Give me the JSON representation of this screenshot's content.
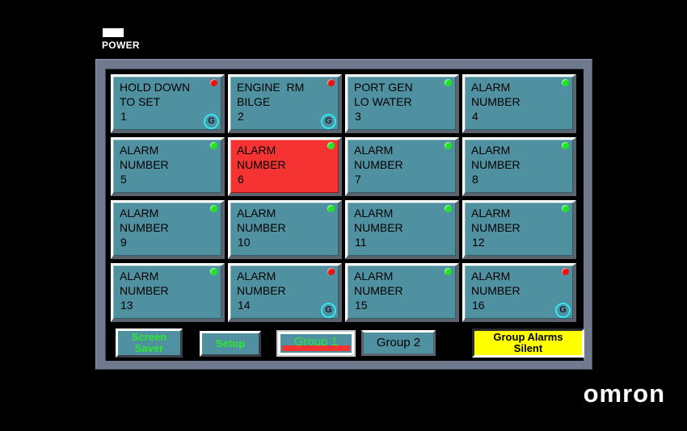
{
  "device": {
    "brand": "omron",
    "power_label": "POWER",
    "power_led_color": "#ffffff",
    "bezel_color": "#6f7a8f",
    "screen_color": "#000000"
  },
  "colors": {
    "tile_normal": "#4f91a0",
    "tile_alarm": "#f53333",
    "led_green": "#22e422",
    "led_red": "#ee1111",
    "group_badge": "#33e8f0",
    "label_green": "#2ee82e",
    "silent_yellow": "#ffff00"
  },
  "alarm_grid": {
    "columns": 4,
    "rows": 4,
    "tiles": [
      {
        "line1": "HOLD DOWN",
        "line2": "TO SET",
        "number": "1",
        "led": "red",
        "state": "normal",
        "group_badge": "G"
      },
      {
        "line1": "ENGINE  RM",
        "line2": "BILGE",
        "number": "2",
        "led": "red",
        "state": "normal",
        "group_badge": "G"
      },
      {
        "line1": "PORT GEN",
        "line2": "LO WATER",
        "number": "3",
        "led": "green",
        "state": "normal",
        "group_badge": ""
      },
      {
        "line1": "ALARM",
        "line2": "NUMBER",
        "number": "4",
        "led": "green",
        "state": "normal",
        "group_badge": ""
      },
      {
        "line1": "ALARM",
        "line2": "NUMBER",
        "number": "5",
        "led": "green",
        "state": "normal",
        "group_badge": ""
      },
      {
        "line1": "ALARM",
        "line2": "NUMBER",
        "number": "6",
        "led": "green",
        "state": "alarm",
        "group_badge": ""
      },
      {
        "line1": "ALARM",
        "line2": "NUMBER",
        "number": "7",
        "led": "green",
        "state": "normal",
        "group_badge": ""
      },
      {
        "line1": "ALARM",
        "line2": "NUMBER",
        "number": "8",
        "led": "green",
        "state": "normal",
        "group_badge": ""
      },
      {
        "line1": "ALARM",
        "line2": "NUMBER",
        "number": "9",
        "led": "green",
        "state": "normal",
        "group_badge": ""
      },
      {
        "line1": "ALARM",
        "line2": "NUMBER",
        "number": "10",
        "led": "green",
        "state": "normal",
        "group_badge": ""
      },
      {
        "line1": "ALARM",
        "line2": "NUMBER",
        "number": "11",
        "led": "green",
        "state": "normal",
        "group_badge": ""
      },
      {
        "line1": "ALARM",
        "line2": "NUMBER",
        "number": "12",
        "led": "green",
        "state": "normal",
        "group_badge": ""
      },
      {
        "line1": "ALARM",
        "line2": "NUMBER",
        "number": "13",
        "led": "green",
        "state": "normal",
        "group_badge": ""
      },
      {
        "line1": "ALARM",
        "line2": "NUMBER",
        "number": "14",
        "led": "red",
        "state": "normal",
        "group_badge": "G"
      },
      {
        "line1": "ALARM",
        "line2": "NUMBER",
        "number": "15",
        "led": "green",
        "state": "normal",
        "group_badge": ""
      },
      {
        "line1": "ALARM",
        "line2": "NUMBER",
        "number": "16",
        "led": "red",
        "state": "normal",
        "group_badge": "G"
      }
    ]
  },
  "button_bar": {
    "screen_saver": {
      "line1": "Screen",
      "line2": "Saver"
    },
    "setup": {
      "line1": "Setup",
      "line2": ""
    },
    "group1": {
      "line1": "Group 1",
      "line2": "",
      "active": true
    },
    "group2": {
      "line1": "Group 2",
      "line2": "",
      "active": false
    },
    "group_alarms_silent": {
      "line1": "Group Alarms",
      "line2": "Silent"
    }
  }
}
